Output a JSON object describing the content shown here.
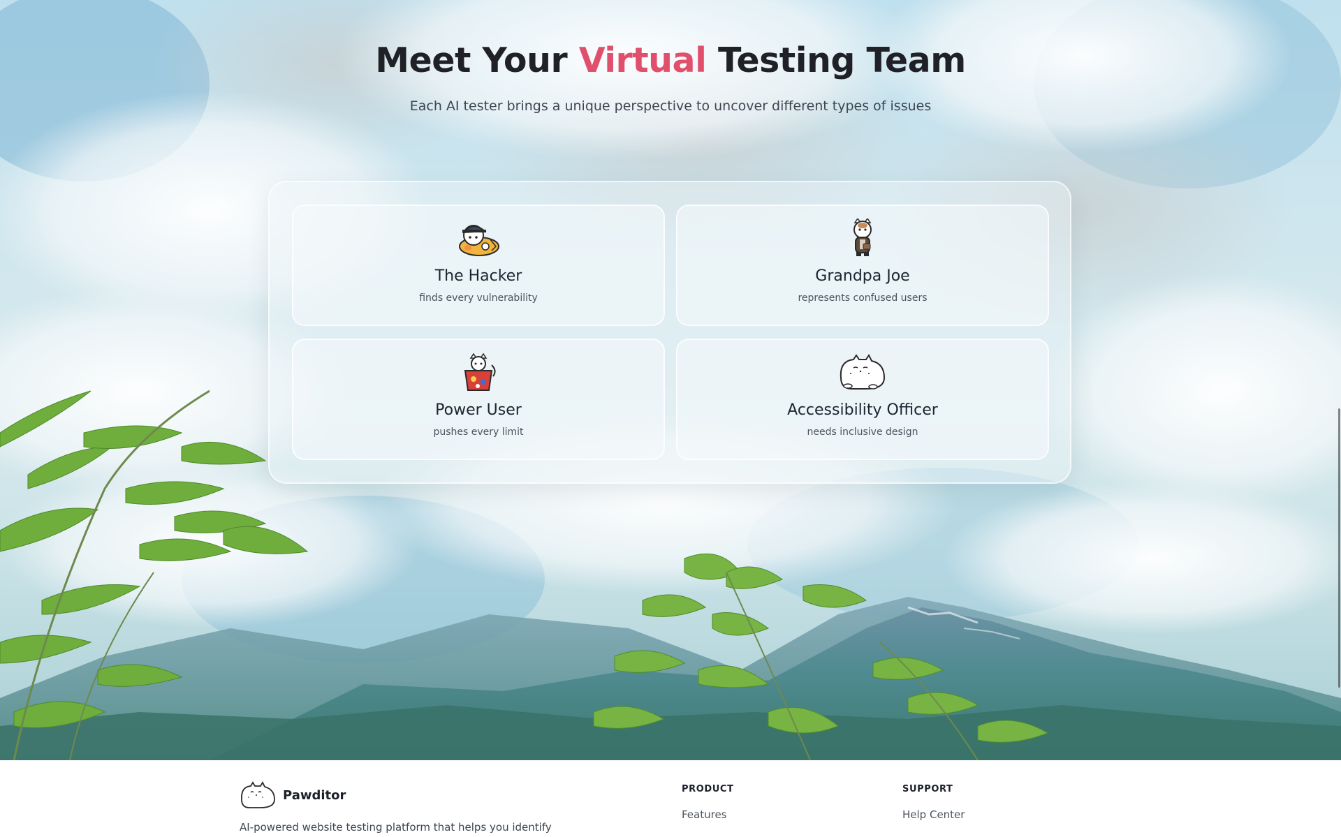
{
  "hero": {
    "title_before": "Meet Your ",
    "title_accent": "Virtual",
    "title_after": " Testing Team",
    "subtitle": "Each AI tester brings a unique perspective to uncover different types of issues"
  },
  "team": [
    {
      "name": "The Hacker",
      "description": "finds every vulnerability",
      "icon": "hacker-cat-icon"
    },
    {
      "name": "Grandpa Joe",
      "description": "represents confused users",
      "icon": "grandpa-cat-icon"
    },
    {
      "name": "Power User",
      "description": "pushes every limit",
      "icon": "power-user-cat-icon"
    },
    {
      "name": "Accessibility Officer",
      "description": "needs inclusive design",
      "icon": "accessibility-cat-icon"
    }
  ],
  "footer": {
    "brand_name": "Pawditor",
    "brand_icon": "pawditor-cat-logo-icon",
    "tagline": "AI-powered website testing platform that helps you identify",
    "columns": [
      {
        "title": "PRODUCT",
        "links": [
          "Features"
        ]
      },
      {
        "title": "SUPPORT",
        "links": [
          "Help Center"
        ]
      }
    ]
  },
  "colors": {
    "accent": "#e0506c",
    "heading": "#1f2126",
    "footer_bg": "#ffffff"
  }
}
